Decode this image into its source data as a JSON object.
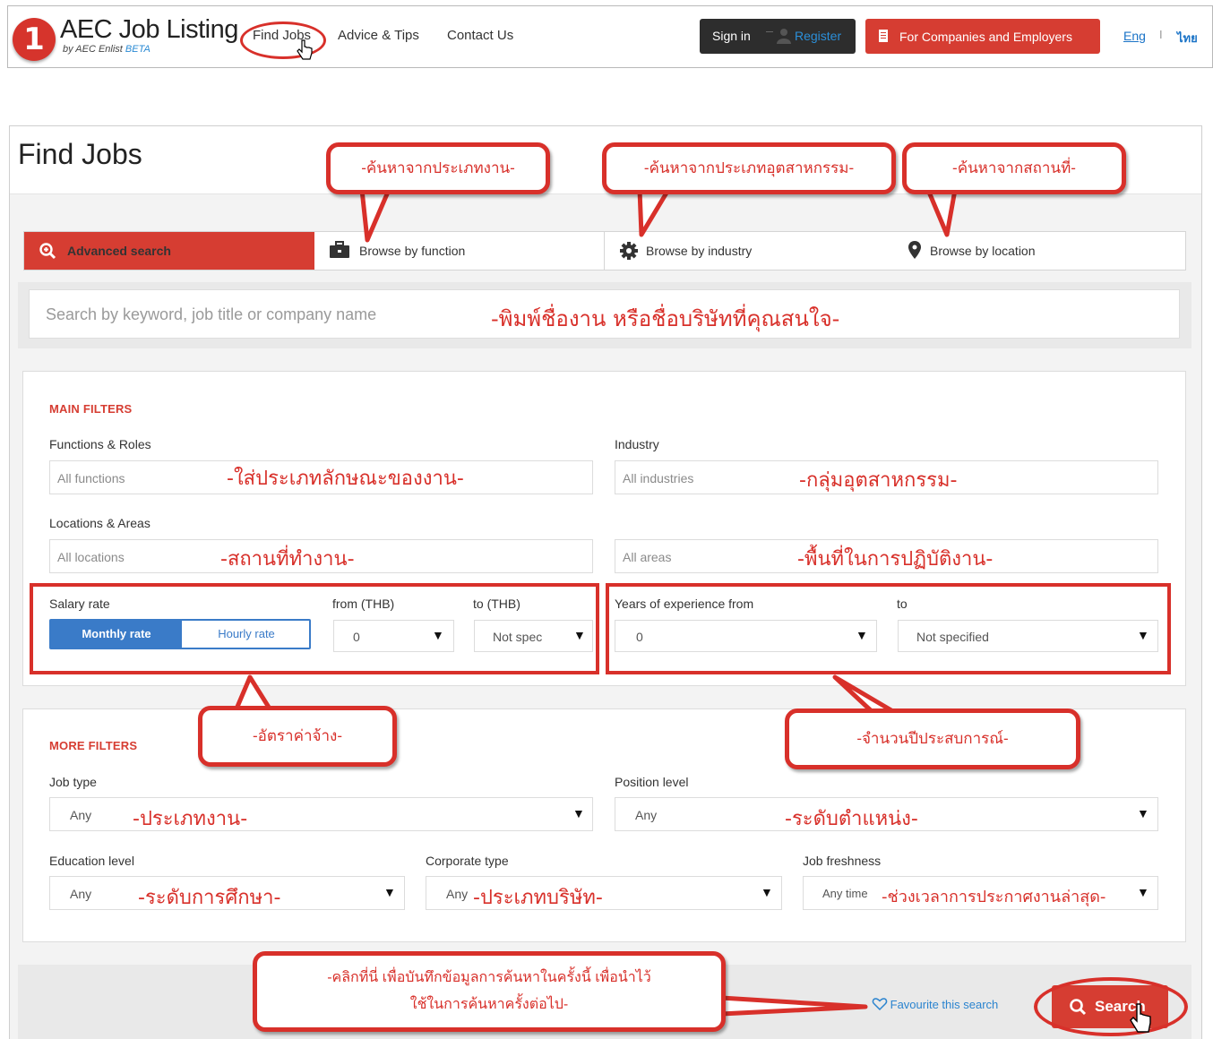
{
  "header": {
    "logo_mark": "1",
    "logo_title": "AEC Job Listing",
    "logo_sub": "by AEC Enlist",
    "logo_beta": "BETA",
    "nav": [
      "Find Jobs",
      "Advice & Tips",
      "Contact Us"
    ],
    "sign_in": "Sign in",
    "register": "Register",
    "employers": "For Companies and Employers",
    "lang_en": "Eng",
    "lang_sep": "I",
    "lang_th": "ไทย"
  },
  "page": {
    "title": "Find Jobs",
    "tabs": [
      "Advanced search",
      "Browse by function",
      "Browse by industry",
      "Browse by location"
    ],
    "search_placeholder": "Search by keyword, job title or company name"
  },
  "main_filters": {
    "title": "MAIN FILTERS",
    "functions_label": "Functions & Roles",
    "functions_placeholder": "All functions",
    "industry_label": "Industry",
    "industry_placeholder": "All industries",
    "locations_label": "Locations & Areas",
    "locations_placeholder": "All locations",
    "areas_placeholder": "All areas",
    "salary_label": "Salary rate",
    "monthly": "Monthly rate",
    "hourly": "Hourly rate",
    "from_label": "from (THB)",
    "to_label": "to (THB)",
    "from_value": "0",
    "to_value": "Not spec",
    "exp_label": "Years of experience from",
    "exp_to_label": "to",
    "exp_from_value": "0",
    "exp_to_value": "Not specified"
  },
  "more_filters": {
    "title": "MORE FILTERS",
    "job_type_label": "Job type",
    "job_type_value": "Any",
    "position_label": "Position level",
    "position_value": "Any",
    "education_label": "Education level",
    "education_value": "Any",
    "corporate_label": "Corporate type",
    "corporate_value": "Any",
    "freshness_label": "Job freshness",
    "freshness_value": "Any time"
  },
  "actions": {
    "favourite": "Favourite this search",
    "search": "Search"
  },
  "annotations": {
    "by_function": "-ค้นหาจากประเภทงาน-",
    "by_industry": "-ค้นหาจากประเภทอุตสาหกรรม-",
    "by_location": "-ค้นหาจากสถานที่-",
    "keyword": "-พิมพ์ชื่องาน หรือชื่อบริษัทที่คุณสนใจ-",
    "functions": "-ใส่ประเภทลักษณะของงาน-",
    "industry": "-กลุ่มอุตสาหกรรม-",
    "location": "-สถานที่ทำงาน-",
    "area": "-พื้นที่ในการปฏิบัติงาน-",
    "salary": "-อัตราค่าจ้าง-",
    "experience": "-จำนวนปีประสบการณ์-",
    "job_type": "-ประเภทงาน-",
    "position": "-ระดับตำแหน่ง-",
    "education": "-ระดับการศึกษา-",
    "corporate": "-ประเภทบริษัท-",
    "freshness": "-ช่วงเวลาการประกาศงานล่าสุด-",
    "favourite_line1": "-คลิกที่นี่ เพื่อบันทึกข้อมูลการค้นหาในครั้งนี้ เพื่อนำไว้",
    "favourite_line2": "ใช้ในการค้นหาครั้งต่อไป-"
  },
  "colors": {
    "brand_red": "#d63d32",
    "annotation_red": "#d8302a",
    "blue": "#3a7bc8",
    "link_blue": "#2b84cf"
  },
  "icons": [
    "magnifier-plus-icon",
    "briefcase-icon",
    "gear-icon",
    "map-pin-icon",
    "user-icon",
    "building-icon",
    "heart-icon",
    "search-icon",
    "hand-cursor-icon"
  ]
}
